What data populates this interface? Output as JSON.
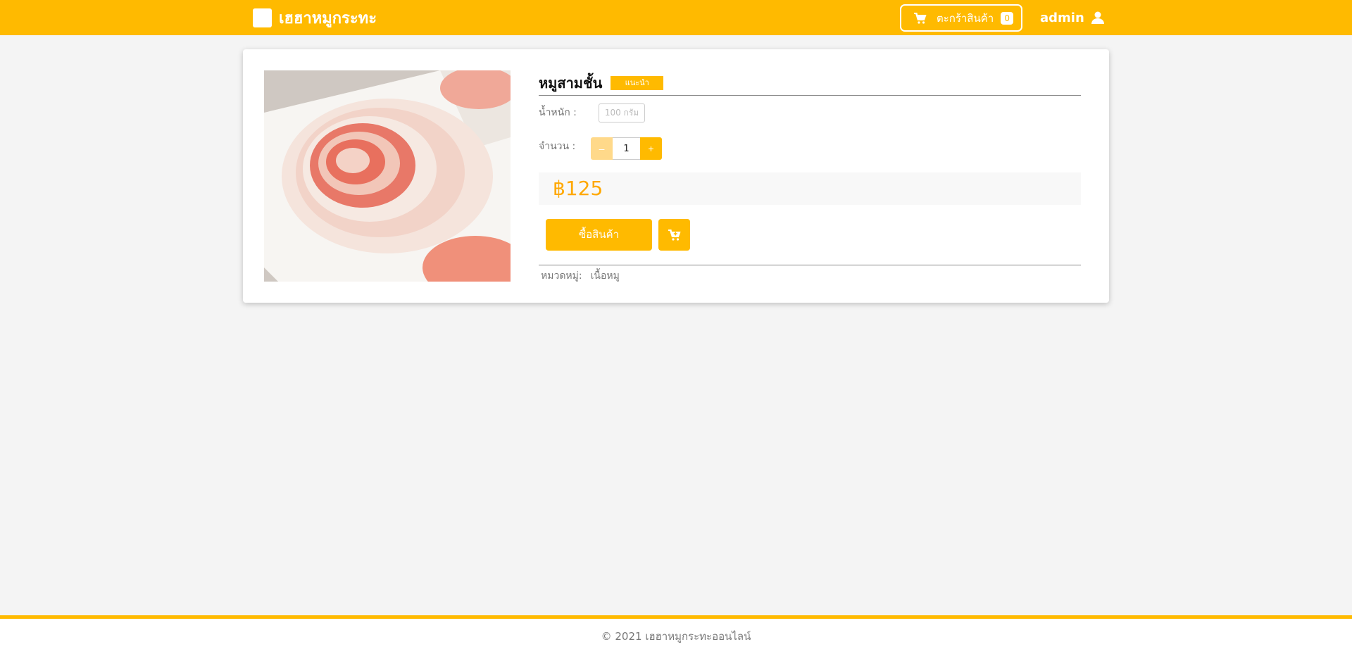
{
  "header": {
    "brand": "เฮฮาหมูกระทะ",
    "cart_label": "ตะกร้าสินค้า",
    "cart_count": "0",
    "user_name": "admin"
  },
  "product": {
    "name": "หมูสามชั้น",
    "badge": "แนะนำ",
    "weight_label": "น้ำหนัก :",
    "weight_value": "100 กรัม",
    "quantity_label": "จำนวน :",
    "quantity_value": "1",
    "minus_label": "–",
    "plus_label": "+",
    "price": "฿125",
    "buy_label": "ซื้อสินค้า",
    "category_label": "หมวดหมู่:",
    "category_value": "เนื้อหมู"
  },
  "footer": {
    "copyright": "© 2021 เฮฮาหมูกระทะออนไลน์"
  },
  "icons": {
    "cart": "cart-icon",
    "user": "user-icon",
    "add_to_cart": "cart-plus-icon"
  },
  "colors": {
    "accent": "#ffba00",
    "price": "#ffa800",
    "background": "#f4f4f4"
  }
}
